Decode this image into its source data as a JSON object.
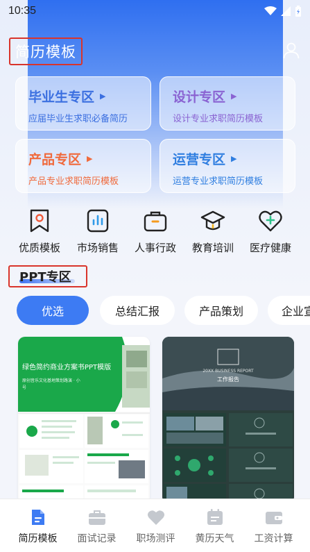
{
  "status_bar": {
    "time": "10:35"
  },
  "header": {
    "title": "简历模板"
  },
  "category_cards": [
    {
      "title": "毕业生专区",
      "subtitle": "应届毕业生求职必备简历",
      "title_color": "#3b6fe0",
      "sub_color": "#3b6fe0"
    },
    {
      "title": "设计专区",
      "subtitle": "设计专业求职简历模板",
      "title_color": "#8a63d2",
      "sub_color": "#8a63d2"
    },
    {
      "title": "产品专区",
      "subtitle": "产品专业求职简历模板",
      "title_color": "#f06a3c",
      "sub_color": "#f06a3c"
    },
    {
      "title": "运营专区",
      "subtitle": "运营专业求职简历模板",
      "title_color": "#2f7ee0",
      "sub_color": "#2f7ee0"
    }
  ],
  "quick_icons": [
    {
      "label": "优质模板",
      "icon": "bookmark-icon"
    },
    {
      "label": "市场销售",
      "icon": "bar-chart-icon"
    },
    {
      "label": "人事行政",
      "icon": "briefcase-icon"
    },
    {
      "label": "教育培训",
      "icon": "graduation-cap-icon"
    },
    {
      "label": "医疗健康",
      "icon": "heart-plus-icon"
    }
  ],
  "ppt_section": {
    "title": "PPT专区"
  },
  "filter_chips": [
    "优选",
    "总结汇报",
    "产品策划",
    "企业宣"
  ],
  "templates": [
    {
      "title": "绿色简约商业方案书PPT模版",
      "subtitle": "原创音乐文化基地策划路演 · 小",
      "extra": "号"
    },
    {
      "cover_title": "工作报告",
      "cover_en": "20XX BUSINESS REPORT"
    }
  ],
  "tabs": [
    {
      "label": "简历模板",
      "icon": "resume-icon"
    },
    {
      "label": "面试记录",
      "icon": "briefcase-icon"
    },
    {
      "label": "职场测评",
      "icon": "heart-icon"
    },
    {
      "label": "黄历天气",
      "icon": "calendar-icon"
    },
    {
      "label": "工资计算",
      "icon": "wallet-icon"
    }
  ],
  "colors": {
    "accent": "#3d7bf3",
    "highlight_box": "#d9342b"
  }
}
